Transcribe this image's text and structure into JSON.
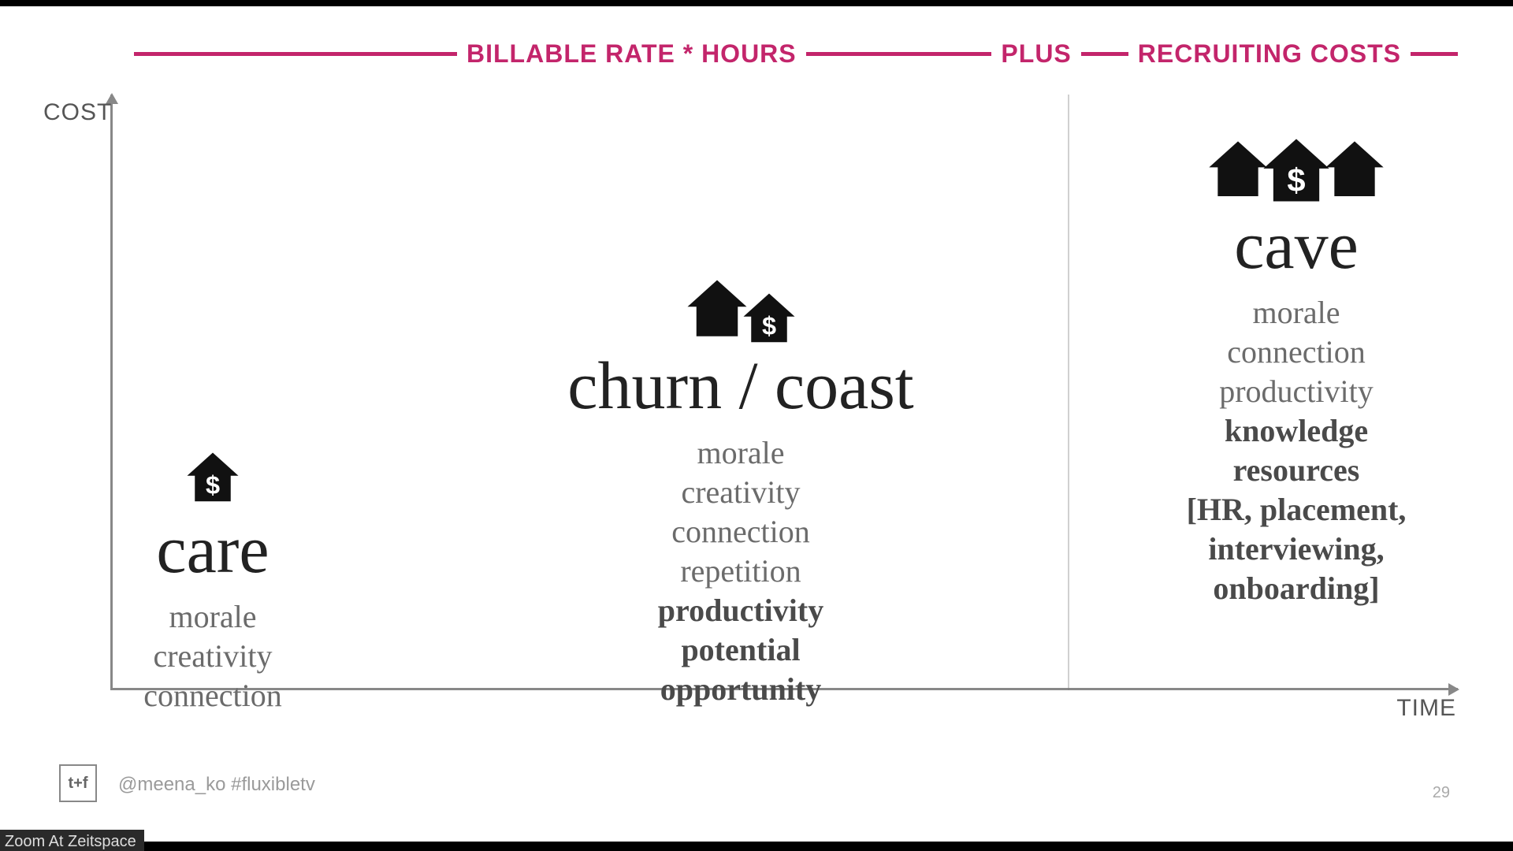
{
  "top": {
    "left_label": "BILLABLE RATE * HOURS",
    "plus": "PLUS",
    "right_label": "RECRUITING COSTS"
  },
  "axes": {
    "y": "COST",
    "x": "TIME"
  },
  "clusters": {
    "care": {
      "title": "care",
      "items": [
        {
          "t": "morale",
          "b": false
        },
        {
          "t": "creativity",
          "b": false
        },
        {
          "t": "connection",
          "b": false
        }
      ]
    },
    "churn": {
      "title": "churn / coast",
      "items": [
        {
          "t": "morale",
          "b": false
        },
        {
          "t": "creativity",
          "b": false
        },
        {
          "t": "connection",
          "b": false
        },
        {
          "t": "repetition",
          "b": false
        },
        {
          "t": "productivity",
          "b": true
        },
        {
          "t": "potential",
          "b": true
        },
        {
          "t": "opportunity",
          "b": true
        }
      ]
    },
    "cave": {
      "title": "cave",
      "items": [
        {
          "t": "morale",
          "b": false
        },
        {
          "t": "connection",
          "b": false
        },
        {
          "t": "productivity",
          "b": false
        },
        {
          "t": "knowledge",
          "b": true
        },
        {
          "t": "resources",
          "b": true
        },
        {
          "t": "[HR, placement,",
          "b": true
        },
        {
          "t": "interviewing,",
          "b": true
        },
        {
          "t": "onboarding]",
          "b": true
        }
      ]
    }
  },
  "footer": {
    "logo": "t+f",
    "handle": "@meena_ko #fluxibletv",
    "page": "29",
    "watermark": "Zoom At Zeitspace"
  }
}
